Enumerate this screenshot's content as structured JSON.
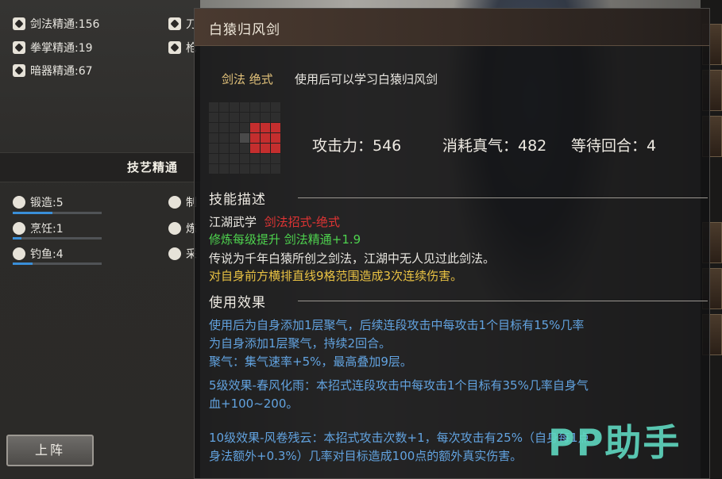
{
  "left_panel": {
    "stats": [
      {
        "label": "剑法精通:156",
        "icon": "sword-icon"
      },
      {
        "label": "拳掌精通:19",
        "icon": "fist-icon"
      },
      {
        "label": "暗器精通:67",
        "icon": "dart-icon"
      },
      {
        "label": "刀",
        "icon": "blade-icon"
      },
      {
        "label": "枪",
        "icon": "spear-icon"
      }
    ],
    "crafts_title": "技艺精通",
    "crafts": [
      {
        "label": "锻造:5",
        "progress": 0.45,
        "icon": "anvil-icon"
      },
      {
        "label": "烹饪:1",
        "progress": 0.1,
        "icon": "pot-icon"
      },
      {
        "label": "钓鱼:4",
        "progress": 0.22,
        "icon": "fish-icon"
      },
      {
        "label": "制",
        "icon": "craft-icon"
      },
      {
        "label": "炼",
        "icon": "furnace-icon"
      },
      {
        "label": "采",
        "icon": "herb-icon"
      }
    ],
    "deploy_label": "上阵"
  },
  "tooltip": {
    "title": "白猿归风剑",
    "skill_type": "剑法 绝式",
    "usage": "使用后可以学习白猿归风剑",
    "attack": "攻击力：546",
    "qi_cost": "消耗真气：482",
    "cooldown": "等待回合：4",
    "desc_title": "技能描述",
    "school": "江湖武学",
    "school_type": "剑法招式-绝式",
    "growth": "修炼每级提升 剑法精通+1.9",
    "lore": "传说为千年白猿所创之剑法，江湖中无人见过此剑法。",
    "range_text": "对自身前方横排直线9格范围造成3次连续伤害。",
    "effect_title": "使用效果",
    "effect1_line1": "使用后为自身添加1层聚气，后续连段攻击中每攻击1个目标有15%几率",
    "effect1_line2": "为自身添加1层聚气，持续2回合。",
    "effect1_line3": "聚气：集气速率+5%，最高叠加9层。",
    "effect2_line1": "5级效果-春风化雨：本招式连段攻击中每攻击1个目标有35%几率自身气",
    "effect2_line2": "血+100~200。",
    "effect3_line1": "10级效果-风卷残云：本招式攻击次数+1，每次攻击有25%（自身每1点",
    "effect3_line2": "身法额外+0.3%）几率对目标造成100点的额外真实伤害。"
  },
  "watermark": "PP助手",
  "colors": {
    "accent_blue": "#62a3e0",
    "green": "#4ed24e",
    "gold": "#e9c243",
    "red": "#e03434"
  }
}
